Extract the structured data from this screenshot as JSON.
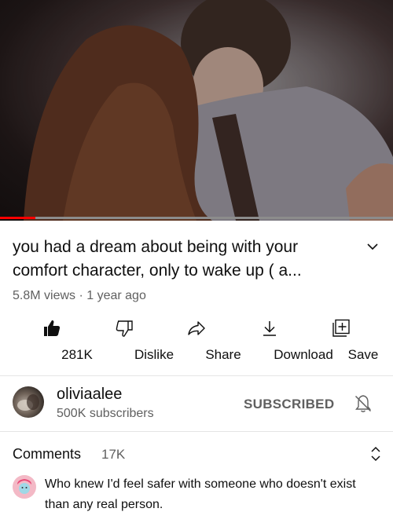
{
  "video": {
    "progress_fraction": 0.09,
    "accent_color": "#ff0000"
  },
  "title": "you had a dream about being with your comfort character, only to wake up ( a...",
  "meta": "5.8M views · 1 year ago",
  "actions": [
    {
      "label": "281K",
      "icon": "thumbs-up-filled-icon"
    },
    {
      "label": "Dislike",
      "icon": "thumbs-down-icon"
    },
    {
      "label": "Share",
      "icon": "share-arrow-icon"
    },
    {
      "label": "Download",
      "icon": "download-icon"
    },
    {
      "label": "Save",
      "icon": "save-playlist-icon"
    }
  ],
  "channel": {
    "name": "oliviaalee",
    "subscribers": "500K subscribers",
    "subscribe_label": "SUBSCRIBED"
  },
  "comments": {
    "label": "Comments",
    "count": "17K",
    "top_comment": "Who knew I'd feel safer with someone who doesn't exist than any real person."
  }
}
